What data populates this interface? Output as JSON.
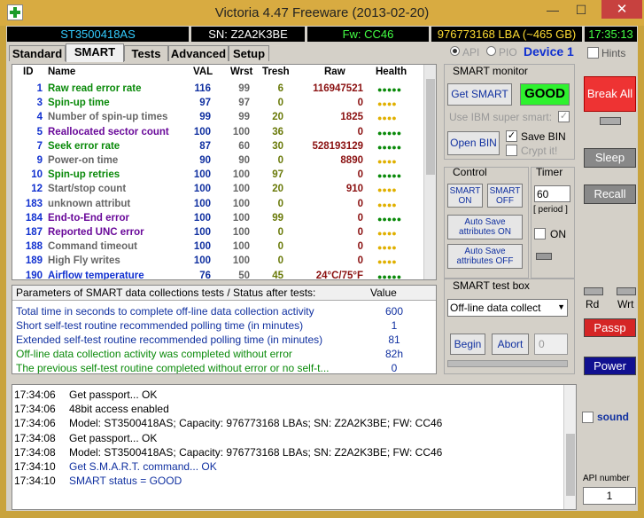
{
  "window": {
    "title": "Victoria 4.47  Freeware (2013-02-20)",
    "minimize": "—",
    "maximize": "☐",
    "close": "✕"
  },
  "status_bar": {
    "model": "ST3500418AS",
    "serial": "SN: Z2A2K3BE",
    "firmware": "Fw: CC46",
    "capacity": "976773168 LBA (~465 GB)",
    "clock": "17:35:13"
  },
  "tabs": [
    "Standard",
    "SMART",
    "Tests",
    "Advanced",
    "Setup"
  ],
  "mode": {
    "api": "API",
    "pio": "PIO",
    "device": "Device 1"
  },
  "hints": "Hints",
  "smart_table": {
    "headers": {
      "id": "ID",
      "name": "Name",
      "val": "VAL",
      "wrst": "Wrst",
      "tresh": "Tresh",
      "raw": "Raw",
      "health": "Health"
    },
    "rows": [
      {
        "id": "1",
        "name": "Raw read error rate",
        "val": "116",
        "wrst": "99",
        "tresh": "6",
        "raw": "116947521",
        "health": "●●●●●",
        "cls": "g",
        "hc": "g"
      },
      {
        "id": "3",
        "name": "Spin-up time",
        "val": "97",
        "wrst": "97",
        "tresh": "0",
        "raw": "0",
        "health": "●●●●",
        "cls": "g",
        "hc": "y"
      },
      {
        "id": "4",
        "name": "Number of spin-up times",
        "val": "99",
        "wrst": "99",
        "tresh": "20",
        "raw": "1825",
        "health": "●●●●",
        "cls": "d",
        "hc": "y"
      },
      {
        "id": "5",
        "name": "Reallocated sector count",
        "val": "100",
        "wrst": "100",
        "tresh": "36",
        "raw": "0",
        "health": "●●●●●",
        "cls": "p",
        "hc": "g"
      },
      {
        "id": "7",
        "name": "Seek error rate",
        "val": "87",
        "wrst": "60",
        "tresh": "30",
        "raw": "528193129",
        "health": "●●●●●",
        "cls": "g",
        "hc": "g"
      },
      {
        "id": "9",
        "name": "Power-on time",
        "val": "90",
        "wrst": "90",
        "tresh": "0",
        "raw": "8890",
        "health": "●●●●",
        "cls": "d",
        "hc": "y"
      },
      {
        "id": "10",
        "name": "Spin-up retries",
        "val": "100",
        "wrst": "100",
        "tresh": "97",
        "raw": "0",
        "health": "●●●●●",
        "cls": "g",
        "hc": "g"
      },
      {
        "id": "12",
        "name": "Start/stop count",
        "val": "100",
        "wrst": "100",
        "tresh": "20",
        "raw": "910",
        "health": "●●●●",
        "cls": "d",
        "hc": "y"
      },
      {
        "id": "183",
        "name": "unknown attribut",
        "val": "100",
        "wrst": "100",
        "tresh": "0",
        "raw": "0",
        "health": "●●●●",
        "cls": "d",
        "hc": "y"
      },
      {
        "id": "184",
        "name": "End-to-End error",
        "val": "100",
        "wrst": "100",
        "tresh": "99",
        "raw": "0",
        "health": "●●●●●",
        "cls": "p",
        "hc": "g"
      },
      {
        "id": "187",
        "name": "Reported UNC error",
        "val": "100",
        "wrst": "100",
        "tresh": "0",
        "raw": "0",
        "health": "●●●●",
        "cls": "p",
        "hc": "y"
      },
      {
        "id": "188",
        "name": "Command timeout",
        "val": "100",
        "wrst": "100",
        "tresh": "0",
        "raw": "0",
        "health": "●●●●",
        "cls": "d",
        "hc": "y"
      },
      {
        "id": "189",
        "name": "High Fly writes",
        "val": "100",
        "wrst": "100",
        "tresh": "0",
        "raw": "0",
        "health": "●●●●",
        "cls": "d",
        "hc": "y"
      },
      {
        "id": "190",
        "name": "Airflow temperature",
        "val": "76",
        "wrst": "50",
        "tresh": "45",
        "raw": "24°C/75°F",
        "health": "●●●●●",
        "cls": "b",
        "hc": "g"
      }
    ]
  },
  "smart_monitor": {
    "title": "SMART monitor",
    "get_smart": "Get SMART",
    "status": "GOOD",
    "ibm": "Use IBM super smart:",
    "open_bin": "Open BIN",
    "save_bin": "Save BIN",
    "crypt": "Crypt it!"
  },
  "control": {
    "title": "Control",
    "smart_on": "SMART ON",
    "smart_off": "SMART OFF",
    "autosave_on": "Auto Save attributes ON",
    "autosave_off": "Auto Save attributes OFF"
  },
  "timer": {
    "title": "Timer",
    "value": "60",
    "period": "[ period ]",
    "on": "ON"
  },
  "params": {
    "header": "Parameters of SMART data collections tests / Status after tests:",
    "value_header": "Value",
    "rows": [
      {
        "text": "Total time in seconds to complete off-line data collection activity",
        "value": "600",
        "c": "#1030a0"
      },
      {
        "text": "Short self-test routine recommended polling time (in minutes)",
        "value": "1",
        "c": "#1030a0"
      },
      {
        "text": "Extended self-test routine recommended polling time (in minutes)",
        "value": "81",
        "c": "#1030a0"
      },
      {
        "text": "Off-line data collection activity was completed without error",
        "value": "82h",
        "c": "#0a8a0a"
      },
      {
        "text": "The previous self-test routine completed without error or no self-t...",
        "value": "0",
        "c": "#0a8a0a"
      }
    ]
  },
  "smart_test": {
    "title": "SMART test box",
    "selected": "Off-line data collect",
    "begin": "Begin",
    "abort": "Abort",
    "value": "0"
  },
  "log": [
    {
      "time": "17:34:06",
      "msg": "Get passport... OK",
      "c": "#000"
    },
    {
      "time": "17:34:06",
      "msg": "48bit access enabled",
      "c": "#000"
    },
    {
      "time": "17:34:06",
      "msg": "Model: ST3500418AS; Capacity: 976773168 LBAs; SN: Z2A2K3BE; FW: CC46",
      "c": "#000"
    },
    {
      "time": "17:34:08",
      "msg": "Get passport... OK",
      "c": "#000"
    },
    {
      "time": "17:34:08",
      "msg": "Model: ST3500418AS; Capacity: 976773168 LBAs; SN: Z2A2K3BE; FW: CC46",
      "c": "#000"
    },
    {
      "time": "17:34:10",
      "msg": "Get S.M.A.R.T. command... OK",
      "c": "#1030a0"
    },
    {
      "time": "17:34:10",
      "msg": "SMART status = GOOD",
      "c": "#1030a0"
    }
  ],
  "right": {
    "break_all": "Break All",
    "sleep": "Sleep",
    "recall": "Recall",
    "rd": "Rd",
    "wrt": "Wrt",
    "passp": "Passp",
    "power": "Power",
    "sound": "sound",
    "api_number": "API number",
    "api_value": "1"
  }
}
